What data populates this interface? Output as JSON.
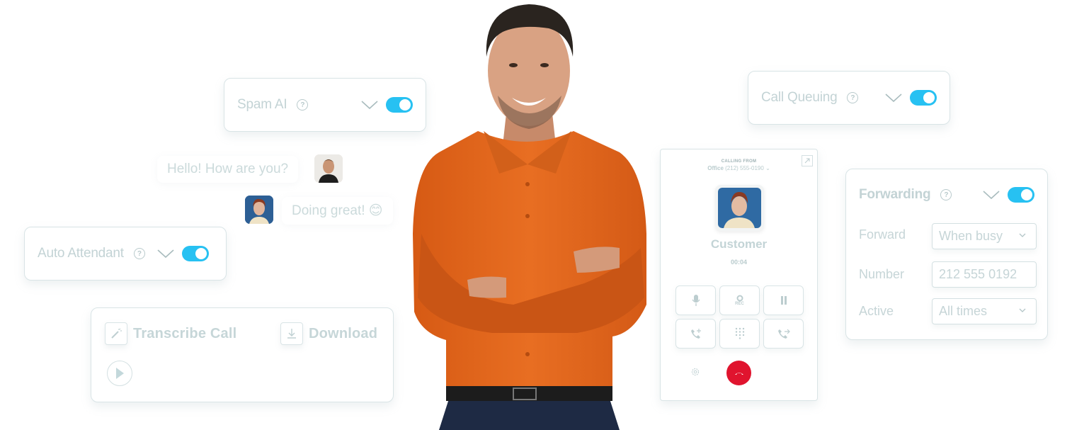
{
  "colors": {
    "toggle_on": "#27c1f2",
    "hangup": "#e0142e",
    "shirt": "#e2661c",
    "muted_text": "#c3d3d5"
  },
  "spam_ai": {
    "title": "Spam AI",
    "help_icon": "help-circle-icon",
    "toggle_on": true
  },
  "chat": {
    "messages": [
      {
        "text": "Hello! How are you?",
        "sender": "male-avatar"
      },
      {
        "text": "Doing great! 😊",
        "sender": "female-avatar"
      }
    ]
  },
  "auto_attendant": {
    "title": "Auto Attendant",
    "help_icon": "help-circle-icon",
    "toggle_on": true
  },
  "transcribe": {
    "transcribe_label": "Transcribe Call",
    "download_label": "Download"
  },
  "call_queuing": {
    "title": "Call Queuing",
    "help_icon": "help-circle-icon",
    "toggle_on": true
  },
  "dialer": {
    "calling_from_label": "CALLING FROM",
    "line_name": "Office",
    "line_number": "(212) 555-0190",
    "contact_name": "Customer",
    "timer": "00:04",
    "rec_label": "REC",
    "buttons": [
      "mute",
      "record",
      "hold",
      "add-call",
      "keypad",
      "transfer"
    ]
  },
  "forwarding": {
    "title": "Forwarding",
    "toggle_on": true,
    "rows": [
      {
        "label": "Forward",
        "value": "When busy",
        "type": "select"
      },
      {
        "label": "Number",
        "value": "212 555 0192",
        "type": "input"
      },
      {
        "label": "Active",
        "value": "All times",
        "type": "select"
      }
    ]
  }
}
